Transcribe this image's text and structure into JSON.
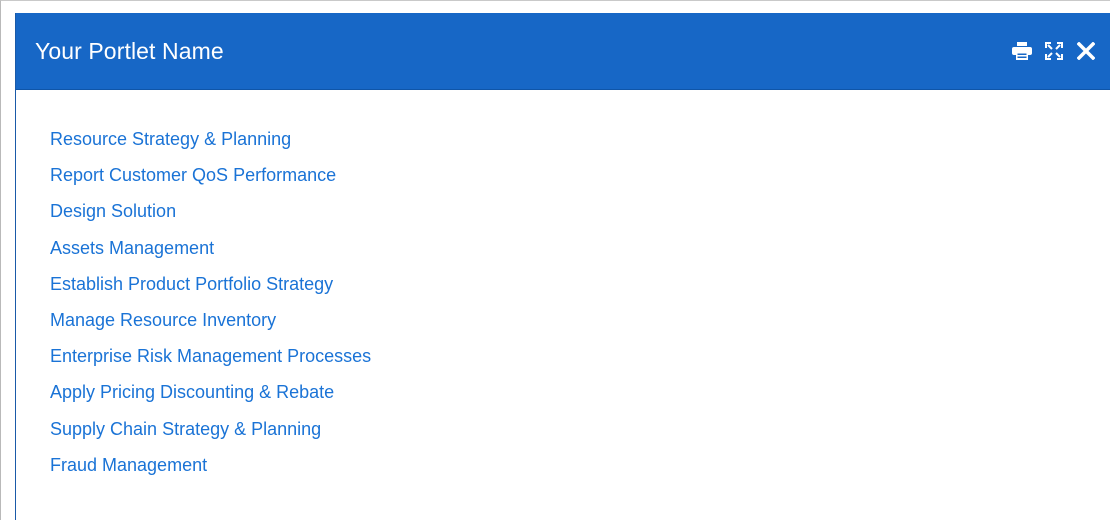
{
  "portlet": {
    "title": "Your Portlet Name",
    "actions": [
      {
        "icon": "print-icon"
      },
      {
        "icon": "expand-icon"
      },
      {
        "icon": "close-icon"
      }
    ],
    "links": [
      "Resource Strategy & Planning",
      "Report Customer QoS Performance",
      "Design Solution",
      "Assets Management",
      "Establish Product Portfolio Strategy",
      "Manage Resource Inventory",
      "Enterprise Risk Management Processes",
      "Apply Pricing Discounting & Rebate",
      "Supply Chain Strategy & Planning",
      "Fraud Management"
    ]
  },
  "colors": {
    "header_bg": "#1767c6",
    "link": "#1a73d6",
    "header_text": "#ffffff"
  }
}
